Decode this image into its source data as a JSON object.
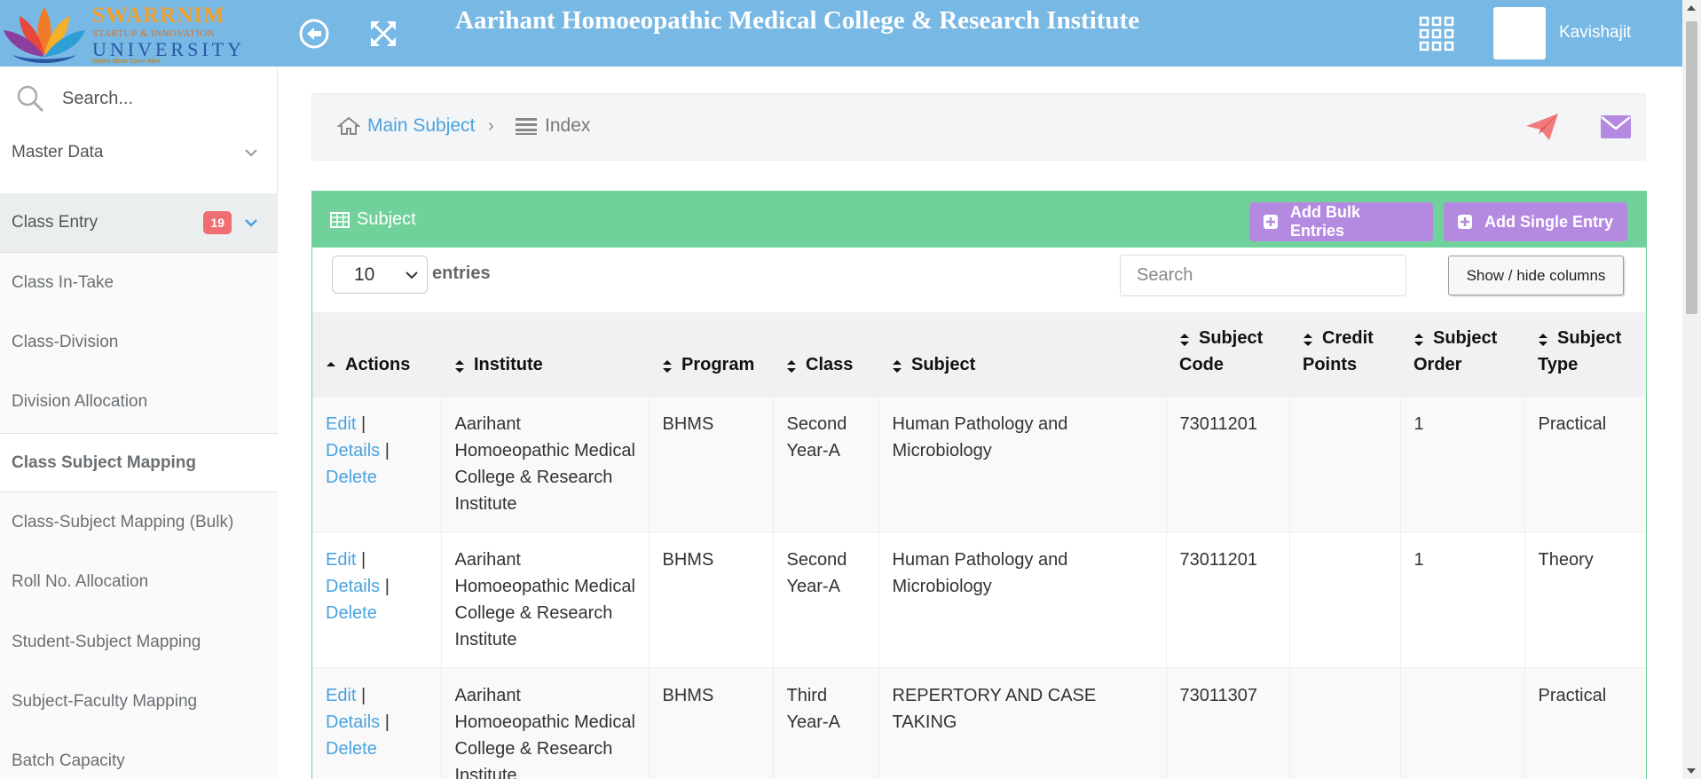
{
  "header": {
    "logo": {
      "line1": "SWARRNIM",
      "line2": "STARTUP & INNOVATION",
      "line3": "UNIVERSITY",
      "line4": "Where Ideas Come Alive"
    },
    "title": "Aarihant Homoeopathic Medical College & Research Institute",
    "username": "Kavishajit"
  },
  "sidebar": {
    "search_placeholder": "Search...",
    "master_data": "Master Data",
    "class_entry": "Class Entry",
    "class_entry_badge": "19",
    "items": [
      {
        "label": "Class In-Take"
      },
      {
        "label": "Class-Division"
      },
      {
        "label": "Division Allocation"
      },
      {
        "label": "Class Subject Mapping"
      },
      {
        "label": "Class-Subject Mapping (Bulk)"
      },
      {
        "label": "Roll No. Allocation"
      },
      {
        "label": "Student-Subject Mapping"
      },
      {
        "label": "Subject-Faculty Mapping"
      },
      {
        "label": "Batch Capacity"
      }
    ]
  },
  "breadcrumb": {
    "home": "Main Subject",
    "current": "Index"
  },
  "panel": {
    "title": "Subject",
    "add_bulk": "Add Bulk Entries",
    "add_single": "Add Single Entry",
    "entries_value": "10",
    "entries_label": "entries",
    "search_placeholder": "Search",
    "show_hide": "Show / hide columns"
  },
  "table": {
    "headers": {
      "actions": "Actions",
      "institute": "Institute",
      "program": "Program",
      "class": "Class",
      "subject": "Subject",
      "subject_code_1": "Subject",
      "subject_code_2": "Code",
      "credit_1": "Credit",
      "credit_2": "Points",
      "order_1": "Subject",
      "order_2": "Order",
      "type_1": "Subject",
      "type_2": "Type"
    },
    "action_labels": {
      "edit": "Edit",
      "details": "Details",
      "delete": "Delete",
      "sep": "|"
    },
    "rows": [
      {
        "institute": "Aarihant Homoeopathic Medical College & Research Institute",
        "program": "BHMS",
        "class": "Second Year-A",
        "subject": "Human Pathology and Microbiology",
        "code": "73011201",
        "credit": "",
        "order": "1",
        "type": "Practical"
      },
      {
        "institute": "Aarihant Homoeopathic Medical College & Research Institute",
        "program": "BHMS",
        "class": "Second Year-A",
        "subject": "Human Pathology and Microbiology",
        "code": "73011201",
        "credit": "",
        "order": "1",
        "type": "Theory"
      },
      {
        "institute": "Aarihant Homoeopathic Medical College & Research Institute",
        "program": "BHMS",
        "class": "Third Year-A",
        "subject": "REPERTORY AND CASE TAKING",
        "code": "73011307",
        "credit": "",
        "order": "",
        "type": "Practical"
      }
    ]
  },
  "colors": {
    "header_bg": "#78b8e4",
    "panel_green": "#71d19a",
    "button_purple": "#b48ae0",
    "link_blue": "#4aa3df",
    "badge_red": "#ee6e73"
  }
}
